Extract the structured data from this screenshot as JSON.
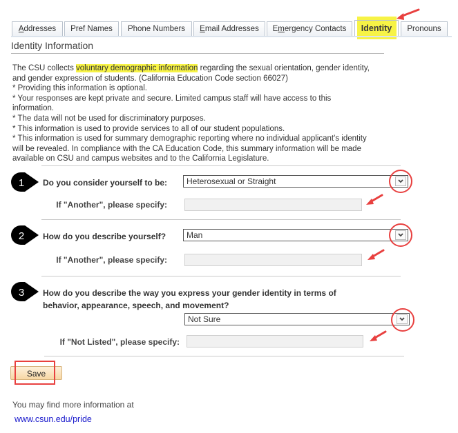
{
  "tabs": [
    {
      "label": "Addresses",
      "access_key": "A",
      "active": false
    },
    {
      "label": "Pref Names",
      "access_key": "",
      "active": false
    },
    {
      "label": "Phone Numbers",
      "access_key": "",
      "active": false
    },
    {
      "label": "Email Addresses",
      "access_key": "E",
      "active": false
    },
    {
      "label": "Emergency Contacts",
      "access_key": "m",
      "active": false
    },
    {
      "label": "Identity",
      "access_key": "",
      "active": true
    },
    {
      "label": "Pronouns",
      "access_key": "",
      "active": false
    }
  ],
  "section_title": "Identity Information",
  "intro": {
    "lead_before": "The CSU collects ",
    "lead_highlight": "voluntary demographic information",
    "lead_after": " regarding the sexual orientation, gender identity, and gender expression of students. (California Education Code section 66027)",
    "bullets": [
      "* Providing this information is optional.",
      "* Your responses are kept private and secure. Limited campus staff will have access to this information.",
      "* The data will not be used for discriminatory purposes.",
      "* This information is used to provide services to all of our student populations.",
      "* This information is used for summary demographic reporting where no individual applicant's identity will be revealed. In compliance with the CA Education Code, this summary information will be made available on CSU and campus websites and to the California Legislature."
    ]
  },
  "questions": [
    {
      "number": "1",
      "label": "Do you consider yourself to be:",
      "selected": "Heterosexual or Straight",
      "specify_label": "If \"Another\", please specify:",
      "specify_value": ""
    },
    {
      "number": "2",
      "label": "How do you describe yourself?",
      "selected": "Man",
      "specify_label": "If \"Another\", please specify:",
      "specify_value": ""
    },
    {
      "number": "3",
      "label_line1": "How do you describe the way you express your gender identity in terms of",
      "label_line2": "behavior, appearance, speech, and movement?",
      "selected": "Not Sure",
      "specify_label": "If \"Not Listed\", please specify:",
      "specify_value": ""
    }
  ],
  "save_label": "Save",
  "more_info_text": "You may find more information at",
  "link_text": "www.csun.edu/pride",
  "colors": {
    "highlight": "#f7f346",
    "annotation_red": "#e8403f",
    "link": "#1a1acc"
  }
}
